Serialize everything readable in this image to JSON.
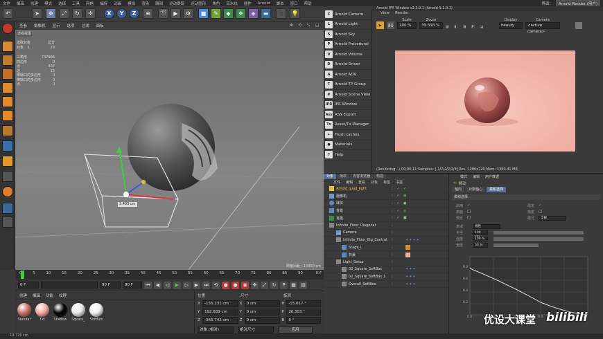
{
  "menubar": {
    "items": [
      "文件",
      "编辑",
      "创建",
      "模式",
      "选择",
      "工具",
      "网格",
      "捕捉",
      "动画",
      "模拟",
      "渲染",
      "雕刻",
      "运动跟踪",
      "运动图形",
      "角色",
      "流水线",
      "插件",
      "Arnold",
      "脚本",
      "窗口",
      "帮助"
    ],
    "interface_label": "界面：",
    "interface_value": "Arnold Render (用户)"
  },
  "toolbar": {
    "x": "X",
    "y": "Y",
    "z": "Z"
  },
  "viewport": {
    "menus": [
      "查看",
      "摄像机",
      "显示",
      "选项",
      "过滤",
      "面板"
    ],
    "title": "透视视图",
    "stats": {
      "selected_label": "选取对象",
      "total_label": "总计",
      "objects_label": "对象",
      "objects_selected": "1",
      "objects_total": "29",
      "polygons_label": "三角形",
      "polygons_total": "737986",
      "lines": [
        [
          "四边形",
          "0"
        ],
        [
          "点",
          "507"
        ],
        [
          "边",
          "13"
        ],
        [
          "带缺口的多边形",
          "0"
        ],
        [
          "带缺口的多边形",
          "0"
        ],
        [
          "点",
          "0"
        ]
      ]
    },
    "measure": "3.483 cm",
    "grid_label": "网格间距 : 10000 cm"
  },
  "timeline": {
    "ticks": [
      "0",
      "5",
      "10",
      "15",
      "20",
      "25",
      "30",
      "35",
      "40",
      "45",
      "50",
      "55",
      "60",
      "65",
      "70",
      "75",
      "80",
      "85",
      "90"
    ],
    "current": "0 F",
    "start": "0 F",
    "end": "90 F",
    "end2": "90 F"
  },
  "materials": {
    "menus": [
      "创建",
      "编辑",
      "功能",
      "纹理"
    ],
    "items": [
      {
        "name": "Standar",
        "color": "#c9706a"
      },
      {
        "name": "Txt",
        "color": "#f5a8a4"
      },
      {
        "name": "Shadow",
        "color": "#050505"
      },
      {
        "name": "Square_",
        "color": "#e8e8e8"
      },
      {
        "name": "SoftBox",
        "color": "#f0f0f0"
      }
    ]
  },
  "coords": {
    "headers": [
      "位置",
      "尺寸",
      "旋转"
    ],
    "rows": [
      {
        "axis": "X",
        "pos": "-155.231 cm",
        "size": "0 cm",
        "rot_axis": "H",
        "rot": "-15.017 °"
      },
      {
        "axis": "Y",
        "pos": "192.689 cm",
        "size": "0 cm",
        "rot_axis": "P",
        "rot": "20.393 °"
      },
      {
        "axis": "Z",
        "pos": "-366.742 cm",
        "size": "0 cm",
        "rot_axis": "B",
        "rot": "0 °"
      }
    ],
    "mode1": "对象 (相对)",
    "mode2": "绝对尺寸",
    "apply": "应用"
  },
  "arnold_menu": {
    "items": [
      {
        "icon": "C",
        "label": "Arnold Camera"
      },
      {
        "icon": "L",
        "label": "Arnold Light"
      },
      {
        "icon": "S",
        "label": "Arnold Sky"
      },
      {
        "icon": "P",
        "label": "Arnold Procedural"
      },
      {
        "icon": "V",
        "label": "Arnold Volume"
      },
      {
        "icon": "D",
        "label": "Arnold Driver"
      },
      {
        "icon": "A",
        "label": "Arnold AOV"
      },
      {
        "icon": "T",
        "label": "Arnold TP Group"
      },
      {
        "icon": "#",
        "label": "Arnold Scene View"
      },
      {
        "icon": "IPR",
        "label": "IPR Window"
      },
      {
        "icon": "Ass",
        "label": "ASS Export"
      },
      {
        "icon": "Tx",
        "label": "Asset/Tx Manager"
      },
      {
        "icon": "✦",
        "label": "Flush caches"
      },
      {
        "icon": "●",
        "label": "Materials"
      },
      {
        "icon": "?",
        "label": "Help"
      }
    ]
  },
  "ipr": {
    "title": "Arnold IPR Window v2.3.0.1 (Arnold 5.1.0.1)",
    "menus": [
      "View",
      "Render"
    ],
    "scale_label": "Scale",
    "scale": "100 %",
    "zoom_label": "Zoom",
    "zoom": "39.518 %",
    "display_label": "Display",
    "display": "beauty",
    "camera_label": "Camera",
    "camera": "<active camera>",
    "status": "(Rendering...)  00:00:11  Samples: [-1/2/2/2/2/3]  Res: 1280x720  Mem: 1380.41 MB"
  },
  "objects": {
    "tabs": [
      "对象",
      "场次",
      "内容浏览器",
      "构造"
    ],
    "menus": [
      "文件",
      "编辑",
      "查看",
      "对象",
      "标签",
      "书签"
    ],
    "rows": [
      {
        "name": "Arnold quad_light",
        "indent": 0,
        "highlight": true
      },
      {
        "name": "摄像机",
        "indent": 0
      },
      {
        "name": "球体",
        "indent": 0
      },
      {
        "name": "背景",
        "indent": 0
      },
      {
        "name": "克隆",
        "indent": 0
      },
      {
        "name": "Infinite_Floor_Diagonal",
        "indent": 0
      },
      {
        "name": "Camera",
        "indent": 1
      },
      {
        "name": "Infinite_Floor_Big_Control",
        "indent": 1
      },
      {
        "name": "Stage_L",
        "indent": 2
      },
      {
        "name": "背景",
        "indent": 2
      },
      {
        "name": "Light_Setup",
        "indent": 1
      },
      {
        "name": "02_Square_SoftBox",
        "indent": 2
      },
      {
        "name": "02_Square_SoftBox.1",
        "indent": 2
      },
      {
        "name": "Overall_SoftBox",
        "indent": 2
      }
    ]
  },
  "attributes": {
    "menus": [
      "模式",
      "编辑",
      "用户数据"
    ],
    "title": "移动",
    "tabs": [
      "轴向",
      "对象轴心",
      "柔和选择"
    ],
    "section": "柔和选择",
    "rows": [
      {
        "label": "启用",
        "value": "✓"
      },
      {
        "label": "限定",
        "value": "✓"
      },
      {
        "label": "表面",
        "value": ""
      },
      {
        "label": "橡皮",
        "value": ""
      },
      {
        "label": "预览",
        "value": ""
      },
      {
        "label": "模式",
        "value": "全部"
      },
      {
        "label": "衰减",
        "value": "线性"
      },
      {
        "label": "半径",
        "value": "100 cm"
      },
      {
        "label": "强度",
        "value": "100 %"
      },
      {
        "label": "宽度",
        "value": "50 %"
      }
    ],
    "graph_y": [
      "0.8",
      "0.6",
      "0.4",
      "0.2"
    ],
    "graph_x": [
      "0.0",
      "0.2",
      "0.4",
      "0.6",
      "0.8",
      "1.0"
    ]
  },
  "watermark": {
    "text": "优设大课堂",
    "brand": "bilibili"
  },
  "status": "19.726 cm"
}
